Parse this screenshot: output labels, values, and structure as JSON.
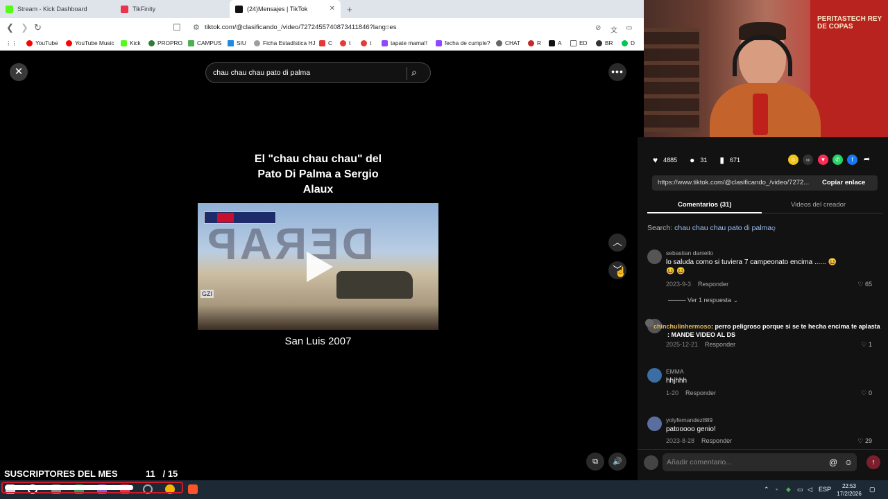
{
  "browser": {
    "tabs": [
      {
        "label": "Stream - Kick Dashboard",
        "color": "#53fc18"
      },
      {
        "label": "TikFinity",
        "color": "#e8344e"
      },
      {
        "label": "(24)Mensajes | TikTok",
        "color": "#111111"
      }
    ],
    "url": "tiktok.com/@clasificando_/video/7272455740873411846?lang=es",
    "bookmarks": [
      {
        "label": "YouTube",
        "color": "#ff0000"
      },
      {
        "label": "YouTube Music",
        "color": "#ff0000"
      },
      {
        "label": "Kick",
        "color": "#53fc18"
      },
      {
        "label": "PROPRO",
        "color": "#2e7d32"
      },
      {
        "label": "CAMPUS",
        "color": "#4caf50"
      },
      {
        "label": "SIU",
        "color": "#1e88e5"
      },
      {
        "label": "Ficha Estadística HJ",
        "color": "#9e9e9e"
      },
      {
        "label": "C",
        "color": "#e53935"
      },
      {
        "label": "t",
        "color": "#e53935"
      },
      {
        "label": "t",
        "color": "#e53935"
      },
      {
        "label": "tapate mama!!",
        "color": "#9146ff"
      },
      {
        "label": "fecha de cumple?",
        "color": "#9146ff"
      },
      {
        "label": "CHAT",
        "color": "#666666"
      },
      {
        "label": "R",
        "color": "#c62828"
      },
      {
        "label": "A",
        "color": "#111111"
      },
      {
        "label": "ED",
        "color": "#666666"
      },
      {
        "label": "BR",
        "color": "#333333"
      },
      {
        "label": "D",
        "color": "#00c853"
      }
    ]
  },
  "tiktok": {
    "search_query": "chau chau chau pato di palma",
    "video_title_lines": [
      "El \"chau chau chau\" del",
      "Pato Di Palma a Sergio",
      "Alaux"
    ],
    "video_caption": "San Luis 2007",
    "stats": {
      "likes": "4885",
      "comments": "31",
      "saves": "671"
    },
    "share_link": "https://www.tiktok.com/@clasificando_/video/7272...",
    "copy_label": "Copiar enlace",
    "tabs": [
      "Comentarios (31)",
      "Videos del creador"
    ],
    "search_prefix": "Search:",
    "search_term": "chau chau chau pato di palma",
    "comments": [
      {
        "user": "sebastian daniello",
        "text": "lo saluda como si tuviera 7 campeonato encima ...... 😆 😆 😆",
        "date": "2023-9-3",
        "reply": "Responder",
        "likes": "65",
        "replies": "Ver 1 respuesta"
      },
      {
        "user": "",
        "text": "",
        "date": "2025-12-21",
        "reply": "Responder",
        "likes": "1"
      },
      {
        "user": "EMMA",
        "text": "hhjhhh",
        "date": "1-20",
        "reply": "Responder",
        "likes": "0"
      },
      {
        "user": "yolyfernandez889",
        "text": "patooooo genio!",
        "date": "2023-8-28",
        "reply": "Responder",
        "likes": "29"
      }
    ],
    "add_comment_placeholder": "Añadir comentario..."
  },
  "stream_chat": {
    "user": "chinchulinhermoso",
    "message": ": perro peligroso porque si se te hecha encima te aplasta",
    "line2": ": MANDE VIDEO AL DS"
  },
  "webcam": {
    "banner_text": "PERITASTECH REY DE COPAS"
  },
  "subs": {
    "label": "SUSCRIPTORES DEL MES",
    "count": "11",
    "goal": "/ 15",
    "progress": 0.733
  },
  "taskbar": {
    "lang": "ESP",
    "time": "22:53",
    "date": "17/2/2026"
  }
}
